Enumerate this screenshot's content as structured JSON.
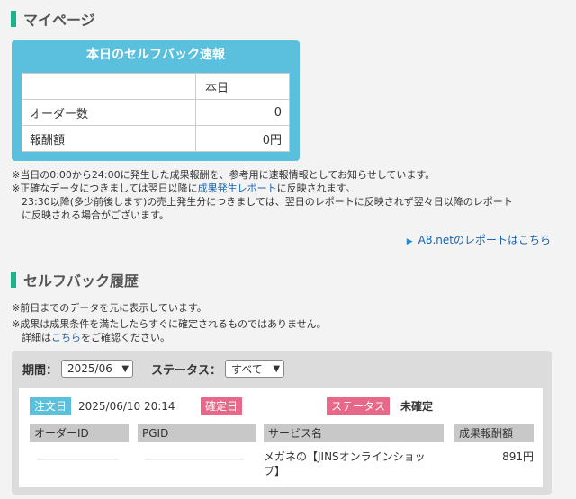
{
  "mypage": {
    "title": "マイページ"
  },
  "report": {
    "title": "本日のセルフバック速報",
    "column_header": "本日",
    "rows": [
      {
        "label": "オーダー数",
        "value": "0"
      },
      {
        "label": "報酬額",
        "value": "0円"
      }
    ]
  },
  "notes1": {
    "line1": "※当日の0:00から24:00に発生した成果報酬を、参考用に速報情報としてお知らせしています。",
    "line2_prefix": "※正確なデータにつきましては翌日以降に",
    "line2_link": "成果発生レポート",
    "line2_suffix": "に反映されます。",
    "line3": "23:30以降(多少前後します)の売上発生分につきましては、翌日のレポートに反映されず翌々日以降のレポート",
    "line4": "に反映される場合がございます。"
  },
  "a8_report_link": "A8.netのレポートはこちら",
  "history": {
    "title": "セルフバック履歴",
    "note1": "※前日までのデータを元に表示しています。",
    "note2": "※成果は成果条件を満たしたらすぐに確定されるものではありません。",
    "note3_prefix": "詳細は",
    "note3_link": "こちら",
    "note3_suffix": "をご確認ください。"
  },
  "filters": {
    "period_label": "期間：",
    "period_value": "2025/06",
    "status_label": "ステータス：",
    "status_value": "すべて"
  },
  "order": {
    "order_date_label": "注文日",
    "order_date_value": "2025/06/10 20:14",
    "confirm_date_label": "確定日",
    "status_label": "ステータス",
    "status_value": "未確定",
    "col_order_id": "オーダーID",
    "col_pgid": "PGID",
    "col_service": "サービス名",
    "col_reward": "成果報酬額",
    "service_name_line1": "メガネの【JINSオンラインショッ",
    "service_name_line2": "プ】",
    "reward_value": "891円"
  },
  "colors": {
    "accent_green": "#1cb38a",
    "report_blue": "#5bc0de",
    "tag_pink": "#e8688a",
    "link_blue": "#1a64b0"
  }
}
